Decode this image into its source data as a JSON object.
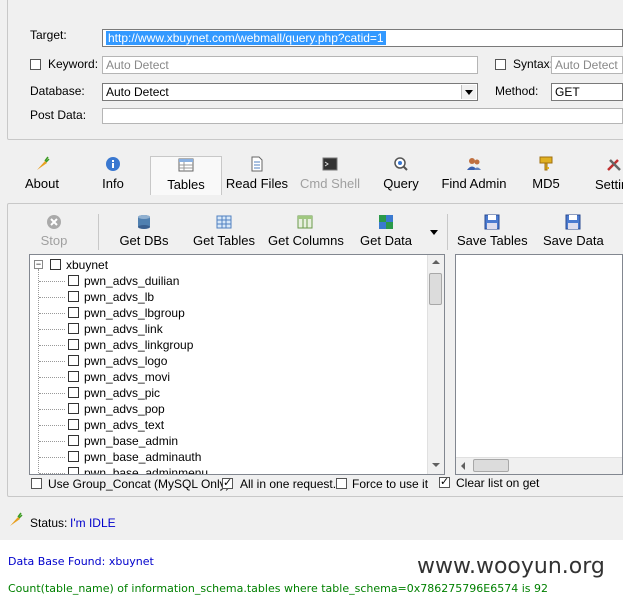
{
  "target": {
    "label": "Target:",
    "value": "http://www.xbuynet.com/webmall/query.php?catid=1"
  },
  "keyword": {
    "label": "Keyword:",
    "value": "Auto Detect"
  },
  "syntax": {
    "label": "Syntax:",
    "value": "Auto Detect"
  },
  "database": {
    "label": "Database:",
    "value": "Auto Detect"
  },
  "method": {
    "label": "Method:",
    "value": "GET"
  },
  "postdata": {
    "label": "Post Data:",
    "value": ""
  },
  "tabs": [
    {
      "label": "About",
      "icon": "carrot-icon"
    },
    {
      "label": "Info",
      "icon": "info-icon"
    },
    {
      "label": "Tables",
      "icon": "table-icon"
    },
    {
      "label": "Read Files",
      "icon": "file-icon"
    },
    {
      "label": "Cmd Shell",
      "icon": "terminal-icon"
    },
    {
      "label": "Query",
      "icon": "query-icon"
    },
    {
      "label": "Find Admin",
      "icon": "users-icon"
    },
    {
      "label": "MD5",
      "icon": "key-icon"
    },
    {
      "label": "Settin",
      "icon": "tools-icon"
    }
  ],
  "toolbar": {
    "stop": "Stop",
    "get_dbs": "Get DBs",
    "get_tables": "Get Tables",
    "get_columns": "Get Columns",
    "get_data": "Get Data",
    "save_tables": "Save Tables",
    "save_data": "Save Data"
  },
  "tree": {
    "root": "xbuynet",
    "items": [
      "pwn_advs_duilian",
      "pwn_advs_lb",
      "pwn_advs_lbgroup",
      "pwn_advs_link",
      "pwn_advs_linkgroup",
      "pwn_advs_logo",
      "pwn_advs_movi",
      "pwn_advs_pic",
      "pwn_advs_pop",
      "pwn_advs_text",
      "pwn_base_admin",
      "pwn_base_adminauth",
      "pwn_base_adminmenu"
    ]
  },
  "options": {
    "group_concat": "Use Group_Concat (MySQL Only)",
    "all_in_one": "All in one request.",
    "force": "Force to use it",
    "clear_list": "Clear list on get"
  },
  "status": {
    "label": "Status:",
    "value": "I'm IDLE"
  },
  "output": {
    "line1": "Data Base Found: xbuynet",
    "line2": "Count(table_name) of information_schema.tables where table_schema=0x786275796E6574 is 92"
  },
  "watermark": "www.wooyun.org",
  "colors": {
    "blue_text": "#0000cc",
    "green_text": "#008000",
    "selection": "#3399ff"
  }
}
